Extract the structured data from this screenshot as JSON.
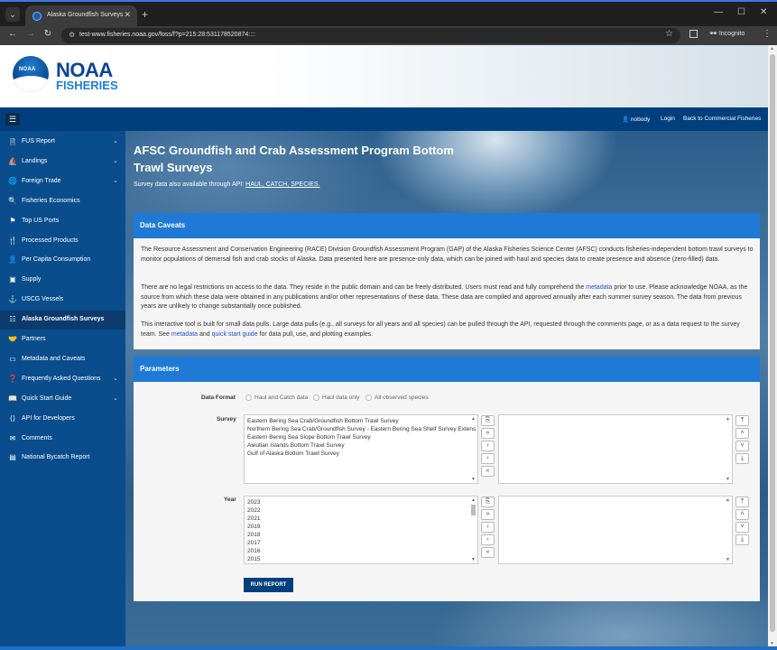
{
  "browser": {
    "tab_title": "Alaska Groundfish Surveys",
    "url": "test-www.fisheries.noaa.gov/foss/f?p=215:28:531178520874::::",
    "incognito_label": "Incognito"
  },
  "logo": {
    "line1": "NOAA",
    "line2": "FISHERIES",
    "badge": "NOAA"
  },
  "topnav": {
    "user": "nobody",
    "login": "Login",
    "back": "Back to Commercial Fisheries"
  },
  "sidebar": {
    "items": [
      {
        "label": "FUS Report",
        "icon": "document-icon",
        "chevron": true
      },
      {
        "label": "Landings",
        "icon": "boat-icon",
        "chevron": true
      },
      {
        "label": "Foreign Trade",
        "icon": "globe-icon",
        "chevron": true
      },
      {
        "label": "Fisheries Economics",
        "icon": "magnify-icon",
        "chevron": false
      },
      {
        "label": "Top US Ports",
        "icon": "flag-icon",
        "chevron": false
      },
      {
        "label": "Processed Products",
        "icon": "utensils-icon",
        "chevron": false
      },
      {
        "label": "Per Capita Consumption",
        "icon": "person-icon",
        "chevron": false
      },
      {
        "label": "Supply",
        "icon": "box-icon",
        "chevron": false
      },
      {
        "label": "USCG Vessels",
        "icon": "anchor-icon",
        "chevron": false
      },
      {
        "label": "Alaska Groundfish Surveys",
        "icon": "list-icon",
        "chevron": false,
        "active": true
      },
      {
        "label": "Partners",
        "icon": "handshake-icon",
        "chevron": false
      },
      {
        "label": "Metadata and Caveats",
        "icon": "folder-icon",
        "chevron": false
      },
      {
        "label": "Frequently Asked Questions",
        "icon": "question-icon",
        "chevron": true
      },
      {
        "label": "Quick Start Guide",
        "icon": "book-icon",
        "chevron": true
      },
      {
        "label": "API for Developers",
        "icon": "code-icon",
        "chevron": false
      },
      {
        "label": "Comments",
        "icon": "mail-icon",
        "chevron": false
      },
      {
        "label": "National Bycatch Report",
        "icon": "report-icon",
        "chevron": false
      }
    ]
  },
  "main": {
    "title": "AFSC Groundfish and Crab Assessment Program Bottom Trawl Surveys",
    "subnote_prefix": "Survey data also available through API:",
    "subnote_links": "HAUL, CATCH, SPECIES."
  },
  "caveats": {
    "heading": "Data Caveats",
    "p1": "The Resource Assessment and Conservation Engineering (RACE) Division Groundfish Assessment Program (GAP) of the Alaska Fisheries Science Center (AFSC) conducts fisheries-independent bottom trawl surveys to monitor populations of demersal fish and crab stocks of Alaska. Data presented here are presence-only data, which can be joined with haul and species data to create presence and absence (zero-filled) data.",
    "p2_a": "There are no legal restrictions on access to the data. They reside in the public domain and can be freely distributed. Users must read and fully comprehend the ",
    "p2_link": "metadata",
    "p2_b": " prior to use. Please acknowledge NOAA, as the source from which these data were obtained in any publications and/or other representations of these data. These data are compiled and approved annually after each summer survey season. The data from previous years are unlikely to change substantially once published.",
    "p3_a": "This interactive tool is built for small data pulls. Large data pulls (e.g., all surveys for all years and all species) can be pulled through the API, requested through the comments page, or as a data request to the survey team. See ",
    "p3_link1": "metadata",
    "p3_and": " and ",
    "p3_link2": "quick start guide",
    "p3_b": " for data pull, use, and plotting examples."
  },
  "params": {
    "heading": "Parameters",
    "format_label": "Data Format",
    "format_options": [
      "Haul and Catch data",
      "Haul data only",
      "All observed species"
    ],
    "survey_label": "Survey",
    "surveys": [
      "Eastern Bering Sea Crab/Groundfish Bottom Trawl Survey",
      "Northern Bering Sea Crab/Groundfish Survey - Eastern Bering Sea Shelf Survey Extens",
      "Eastern Bering Sea Slope Bottom Trawl Survey",
      "Aleutian Islands Bottom Trawl Survey",
      "Gulf of Alaska Bottom Trawl Survey"
    ],
    "year_label": "Year",
    "years": [
      "2023",
      "2022",
      "2021",
      "2019",
      "2018",
      "2017",
      "2016",
      "2015"
    ],
    "run_button": "RUN REPORT"
  }
}
